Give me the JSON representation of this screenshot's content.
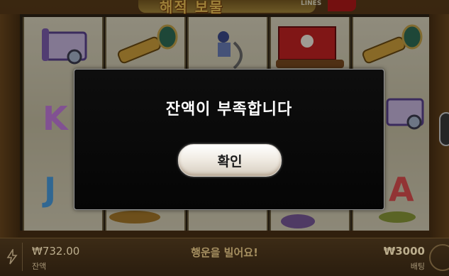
{
  "header": {
    "title": "해적 보물",
    "lines_label": "LINES"
  },
  "modal": {
    "message": "잔액이 부족합니다",
    "confirm_label": "확인"
  },
  "bottom_bar": {
    "balance_value": "₩732.00",
    "balance_label": "잔액",
    "luck_message": "행운을 빌어요!",
    "bet_value": "₩3000",
    "bet_label": "배팅"
  },
  "reel_letters": [
    "K",
    "J",
    "A"
  ],
  "colors": {
    "modal_bg": "#0a0a0a",
    "button_bg": "#f1ece4",
    "bar_text": "#bcae8e",
    "luck_text": "#a58f60"
  },
  "icons": [
    "map-scroll-icon",
    "spyglass-icon",
    "pirate-icon",
    "pirate-ship-icon",
    "bolt-icon",
    "spin-icon"
  ]
}
